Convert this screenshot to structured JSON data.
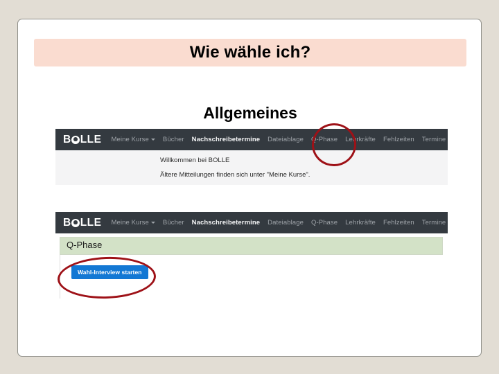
{
  "slide": {
    "title": "Wie wähle ich?",
    "subtitle": "Allgemeines",
    "title_banner_color": "#fadcd0",
    "background_color": "#e2ddd4",
    "annotation_color": "#9e1117"
  },
  "screenshot_one": {
    "navbar": {
      "brand_left": "B",
      "brand_right": "LLE",
      "brand_icon": "bolle-face-logo-icon",
      "items": [
        {
          "label": "Meine Kurse",
          "has_caret": true,
          "active": false
        },
        {
          "label": "Bücher",
          "has_caret": false,
          "active": false
        },
        {
          "label": "Nachschreibetermine",
          "has_caret": false,
          "active": true
        },
        {
          "label": "Dateiablage",
          "has_caret": false,
          "active": false
        },
        {
          "label": "Q-Phase",
          "has_caret": false,
          "active": false
        },
        {
          "label": "Lehrkräfte",
          "has_caret": false,
          "active": false
        },
        {
          "label": "Fehlzeiten",
          "has_caret": false,
          "active": false
        },
        {
          "label": "Termine",
          "has_caret": false,
          "active": false
        }
      ]
    },
    "body": {
      "line_1": "Willkommen bei BOLLE",
      "line_2": "Ältere Mitteilungen finden sich unter \"Meine Kurse\"."
    },
    "annotation": {
      "name": "q-phase-highlight-ellipse",
      "target": "Q-Phase"
    }
  },
  "screenshot_two": {
    "navbar": {
      "brand_left": "B",
      "brand_right": "LLE",
      "brand_icon": "bolle-face-logo-icon",
      "items": [
        {
          "label": "Meine Kurse",
          "has_caret": true,
          "active": false
        },
        {
          "label": "Bücher",
          "has_caret": false,
          "active": false
        },
        {
          "label": "Nachschreibetermine",
          "has_caret": false,
          "active": true
        },
        {
          "label": "Dateiablage",
          "has_caret": false,
          "active": false
        },
        {
          "label": "Q-Phase",
          "has_caret": false,
          "active": false
        },
        {
          "label": "Lehrkräfte",
          "has_caret": false,
          "active": false
        },
        {
          "label": "Fehlzeiten",
          "has_caret": false,
          "active": false
        },
        {
          "label": "Termine",
          "has_caret": false,
          "active": false
        }
      ]
    },
    "page_heading": "Q-Phase",
    "page_heading_color": "#d3e2c7",
    "primary_button": {
      "label": "Wahl-Interview starten",
      "color": "#1378d4"
    },
    "annotation": {
      "name": "start-button-highlight-ellipse",
      "target": "Wahl-Interview starten"
    }
  }
}
